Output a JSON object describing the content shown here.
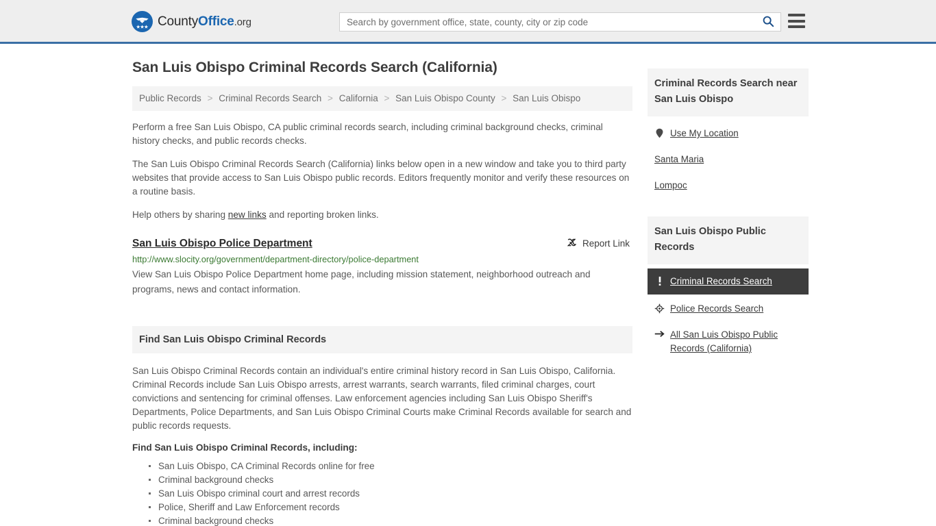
{
  "header": {
    "logo": {
      "icon": "eagle-shield-logo",
      "text_county": "County",
      "text_office": "Office",
      "text_org": ".org"
    },
    "search": {
      "placeholder": "Search by government office, state, county, city or zip code",
      "value": "",
      "icon": "search-icon"
    },
    "menu_icon": "hamburger-menu-icon",
    "accent_color": "#3a6fa5"
  },
  "page": {
    "title": "San Luis Obispo Criminal Records Search (California)",
    "breadcrumb": [
      "Public Records",
      "Criminal Records Search",
      "California",
      "San Luis Obispo County",
      "San Luis Obispo"
    ],
    "breadcrumb_separator": ">",
    "intro_paragraphs": [
      "Perform a free San Luis Obispo, CA public criminal records search, including criminal background checks, criminal history checks, and public records checks.",
      "The San Luis Obispo Criminal Records Search (California) links below open in a new window and take you to third party websites that provide access to San Luis Obispo public records. Editors frequently monitor and verify these resources on a routine basis."
    ],
    "help_line": {
      "before": "Help others by sharing ",
      "link": "new links",
      "after": " and reporting broken links."
    }
  },
  "result": {
    "title": "San Luis Obispo Police Department",
    "url": "http://www.slocity.org/government/department-directory/police-department",
    "description": "View San Luis Obispo Police Department home page, including mission statement, neighborhood outreach and programs, news and contact information.",
    "report_label": "Report Link",
    "report_icon": "broken-link-icon",
    "url_color": "#3b7a33"
  },
  "section": {
    "heading": "Find San Luis Obispo Criminal Records",
    "paragraph": "San Luis Obispo Criminal Records contain an individual's entire criminal history record in San Luis Obispo, California. Criminal Records include San Luis Obispo arrests, arrest warrants, search warrants, filed criminal charges, court convictions and sentencing for criminal offenses. Law enforcement agencies including San Luis Obispo Sheriff's Departments, Police Departments, and San Luis Obispo Criminal Courts make Criminal Records available for search and public records requests.",
    "sub_heading": "Find San Luis Obispo Criminal Records, including:",
    "bullets": [
      "San Luis Obispo, CA Criminal Records online for free",
      "Criminal background checks",
      "San Luis Obispo criminal court and arrest records",
      "Police, Sheriff and Law Enforcement records",
      "Criminal background checks"
    ]
  },
  "sidebar": {
    "nearby_card": {
      "title": "Criminal Records Search near San Luis Obispo",
      "items": [
        {
          "label": "Use My Location",
          "icon": "map-pin-icon"
        },
        {
          "label": "Santa Maria",
          "icon": "none"
        },
        {
          "label": "Lompoc",
          "icon": "none"
        }
      ]
    },
    "records_card": {
      "title": "San Luis Obispo Public Records",
      "items": [
        {
          "label": "Criminal Records Search",
          "icon": "exclamation-icon",
          "active": true
        },
        {
          "label": "Police Records Search",
          "icon": "police-badge-icon",
          "active": false
        },
        {
          "label": "All San Luis Obispo Public Records (California)",
          "icon": "arrow-right-icon",
          "active": false
        }
      ],
      "active_bg": "#3d3d3d"
    }
  }
}
